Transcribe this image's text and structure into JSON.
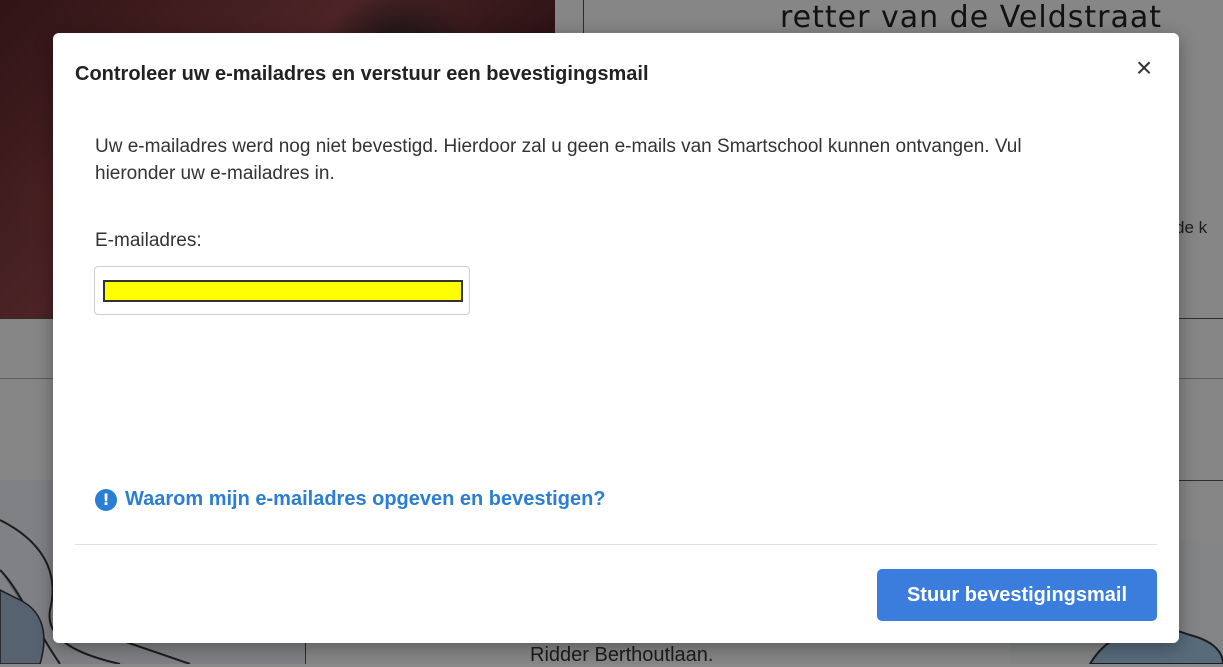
{
  "background": {
    "title": "retter van de Veldstraat",
    "side_text": "de k",
    "bottom_text": "Ridder Berthoutlaan."
  },
  "modal": {
    "title": "Controleer uw e-mailadres en verstuur een bevestigingsmail",
    "close_label": "×",
    "body_text": "Uw e-mailadres werd nog niet bevestigd. Hierdoor zal u geen e-mails van Smartschool kunnen ontvangen. Vul hieronder uw e-mailadres in.",
    "email_label": "E-mailadres:",
    "email_value": "",
    "help_icon": "!",
    "help_link": "Waarom mijn e-mailadres opgeven en bevestigen?",
    "submit_label": "Stuur bevestigingsmail"
  },
  "colors": {
    "accent": "#3b7ddd",
    "link": "#2a7fd4",
    "input_highlight": "#ffff00"
  },
  "icons": {
    "close": "close-icon",
    "help": "info-circle-icon"
  }
}
